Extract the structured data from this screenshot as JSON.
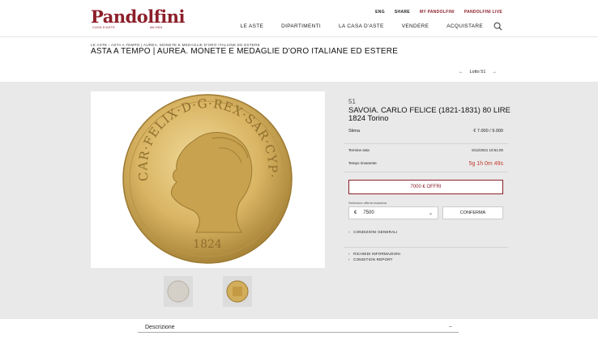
{
  "brand": {
    "name": "Pandolfini",
    "sub": "CASA D'ASTE",
    "year": "dal 1924"
  },
  "toplinks": [
    "ENG",
    "SHARE",
    "MY PANDOLFINI",
    "PANDOLFINI LIVE"
  ],
  "nav": [
    "LE ASTE",
    "DIPARTIMENTI",
    "LA CASA D'ASTE",
    "VENDERE",
    "ACQUISTARE"
  ],
  "breadcrumb": "LE ASTE  ›  ASTA A TEMPO | AUREA. MONETE E MEDAGLIE D'ORO ITALIANE ED ESTERE",
  "page_title": "ASTA A TEMPO | AUREA. MONETE E MEDAGLIE D'ORO ITALIANE ED ESTERE",
  "lot_nav": {
    "label": "Lotto 51"
  },
  "lot": {
    "number": "51",
    "title": "SAVOIA. CARLO FELICE (1821-1831) 80 LIRE 1824 Torino",
    "estimate_label": "Stima",
    "estimate_value": "€ 7.000 / 9.000",
    "end_label": "Termine asta",
    "end_value": "6/12/2021 10:51:00",
    "remaining_label": "Tempo rimanente",
    "remaining_value": "5g 1h 0m 49s",
    "bid_button": "7000 € OFFRI",
    "select_label": "Selezione offerta massima",
    "currency": "€",
    "select_value": "7500",
    "confirm_button": "CONFERMA",
    "conditions": "CONDIZIONI GENERALI",
    "request_info": "RICHIEDI INFORMAZIONI",
    "condition_report": "CONDITION REPORT"
  },
  "coin": {
    "legend": "CAR·FELIX·D·G·REX·SAR·CYP·ET·HIER·",
    "date": "1824"
  },
  "description_label": "Descrizione",
  "colors": {
    "brand": "#8c1f2a",
    "accent_red": "#c0392b",
    "background_gray": "#e9e9e9",
    "gold": "#c9a85a"
  }
}
